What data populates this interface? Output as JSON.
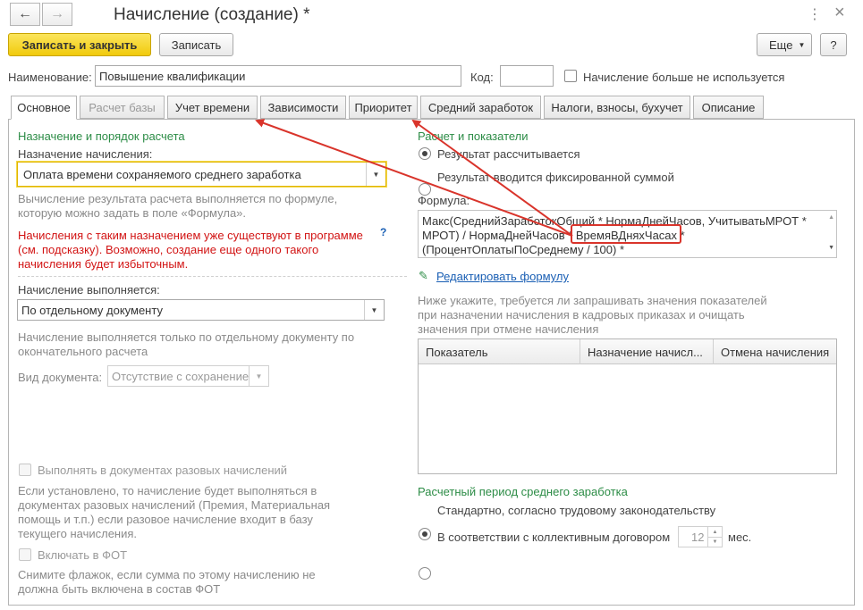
{
  "window": {
    "title": "Начисление (создание) *",
    "back_icon": "←",
    "forward_icon": "→",
    "menu_icon": "⋮",
    "close_icon": "×"
  },
  "toolbar": {
    "save_close": "Записать и закрыть",
    "save": "Записать",
    "more": "Еще",
    "help": "?"
  },
  "header": {
    "name_label": "Наименование:",
    "name_value": "Повышение квалификации",
    "code_label": "Код:",
    "code_value": "",
    "unused_label": "Начисление больше не используется"
  },
  "tabs": [
    {
      "label": "Основное",
      "state": "active"
    },
    {
      "label": "Расчет базы",
      "state": "disabled"
    },
    {
      "label": "Учет времени",
      "state": "normal"
    },
    {
      "label": "Зависимости",
      "state": "normal"
    },
    {
      "label": "Приоритет",
      "state": "normal"
    },
    {
      "label": "Средний заработок",
      "state": "normal"
    },
    {
      "label": "Налоги, взносы, бухучет",
      "state": "normal"
    },
    {
      "label": "Описание",
      "state": "normal"
    }
  ],
  "left": {
    "section_title": "Назначение и порядок расчета",
    "purpose_label": "Назначение начисления:",
    "purpose_value": "Оплата времени сохраняемого среднего заработка",
    "formula_hint_1": "Вычисление результата расчета выполняется по формуле,",
    "formula_hint_2": "которую можно задать в поле «Формула».",
    "warning_1": "Начисления с таким назначением уже существуют в программе",
    "warning_2": "(см. подсказку). Возможно, создание еще одного такого",
    "warning_3": "начисления будет избыточным.",
    "warning_help": "?",
    "exec_label": "Начисление выполняется:",
    "exec_value": "По отдельному документу",
    "exec_hint_1": "Начисление выполняется только по отдельному документу по",
    "exec_hint_2": "окончательного расчета",
    "doc_type_label": "Вид документа:",
    "doc_type_value": "Отсутствие с сохранением",
    "onetime_label": "Выполнять в документах разовых начислений",
    "onetime_hint_1": "Если установлено, то начисление будет выполняться в",
    "onetime_hint_2": "документах разовых начислений (Премия, Материальная",
    "onetime_hint_3": "помощь и т.п.) если разовое начисление входит в базу",
    "onetime_hint_4": "текущего начисления.",
    "fot_label": "Включать в ФОТ",
    "fot_hint_1": "Снимите флажок, если сумма по этому начислению не",
    "fot_hint_2": "должна быть включена в состав ФОТ"
  },
  "right": {
    "section_title": "Расчет и показатели",
    "radio_calc": "Результат рассчитывается",
    "radio_fixed": "Результат вводится фиксированной суммой",
    "formula_label": "Формула:",
    "formula_line1": "Макс(СреднийЗаработокОбщий * НормаДнейЧасов, УчитыватьМРОТ *",
    "formula_line2_a": "МРОТ) / НормаДнейЧасов * ",
    "formula_line2_highlight": "ВремяВДняхЧасах",
    "formula_line2_b": " *",
    "formula_line3": "(ПроцентОплатыПоСреднему / 100) *",
    "edit_formula": "Редактировать формулу",
    "indicators_hint_1": "Ниже укажите, требуется ли запрашивать значения показателей",
    "indicators_hint_2": "при назначении начисления в кадровых приказах и очищать",
    "indicators_hint_3": "значения при отмене начисления",
    "table_headers": [
      "Показатель",
      "Назначение начисл...",
      "Отмена начисления"
    ],
    "period_title": "Расчетный период среднего заработка",
    "period_standard": "Стандартно, согласно трудовому законодательству",
    "period_contract": "В соответствии с коллективным договором",
    "months_value": "12",
    "months_unit": "мес."
  },
  "colors": {
    "accent_yellow": "#f1ca0c",
    "green_heading": "#2c8c46",
    "warning_red": "#d21414",
    "annotation_red": "#d9342b",
    "link_blue": "#1a5fb4"
  }
}
